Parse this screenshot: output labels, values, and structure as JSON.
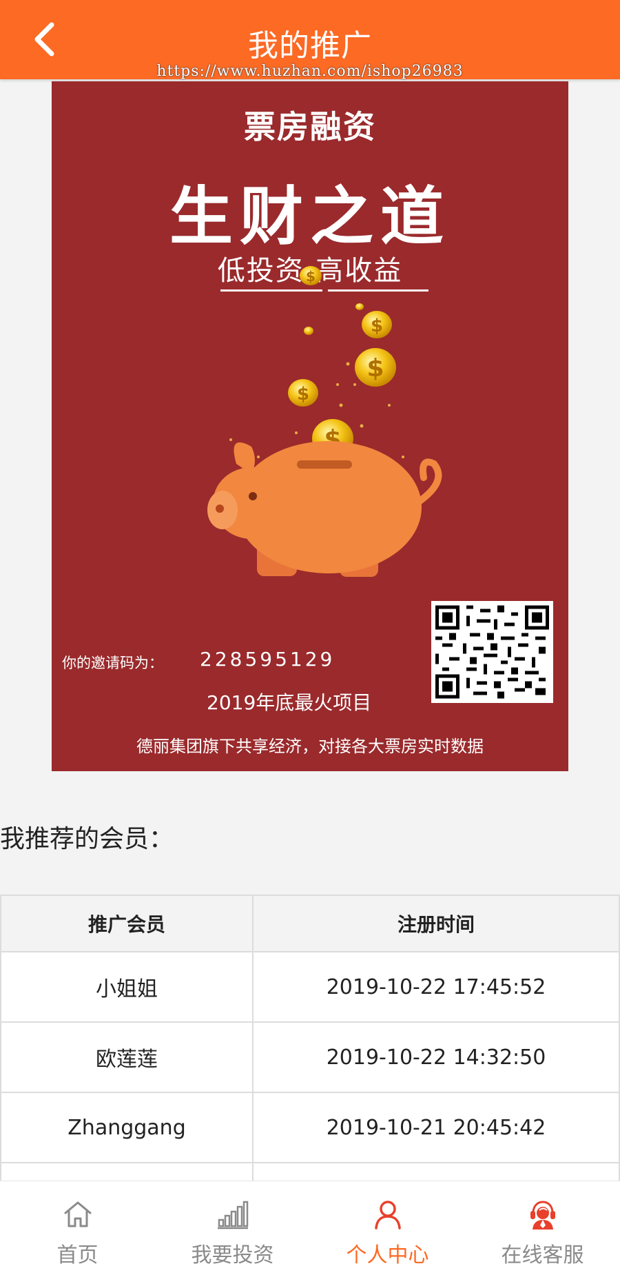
{
  "header": {
    "title": "我的推广",
    "watermark": "https://www.huzhan.com/ishop26983",
    "accent_color": "#fc6a24"
  },
  "poster": {
    "brand": "票房融资",
    "slogan": "生财之道",
    "subtitle": "低投资-高收益",
    "invite_label": "你的邀请码为：",
    "invite_code": "228595129",
    "hot_text": "2019年底最火项目",
    "description": "德丽集团旗下共享经济，对接各大票房实时数据",
    "background_color": "#9a2a2c"
  },
  "members": {
    "section_title": "我推荐的会员：",
    "columns": [
      "推广会员",
      "注册时间"
    ],
    "rows": [
      {
        "name": "小姐姐",
        "time": "2019-10-22 17:45:52"
      },
      {
        "name": "欧莲莲",
        "time": "2019-10-22 14:32:50"
      },
      {
        "name": "Zhanggang",
        "time": "2019-10-21 20:45:42"
      }
    ]
  },
  "tabbar": {
    "items": [
      {
        "label": "首页",
        "icon": "home-icon"
      },
      {
        "label": "我要投资",
        "icon": "bar-chart-icon"
      },
      {
        "label": "个人中心",
        "icon": "user-icon",
        "active": true
      },
      {
        "label": "在线客服",
        "icon": "customer-service-icon"
      }
    ]
  }
}
